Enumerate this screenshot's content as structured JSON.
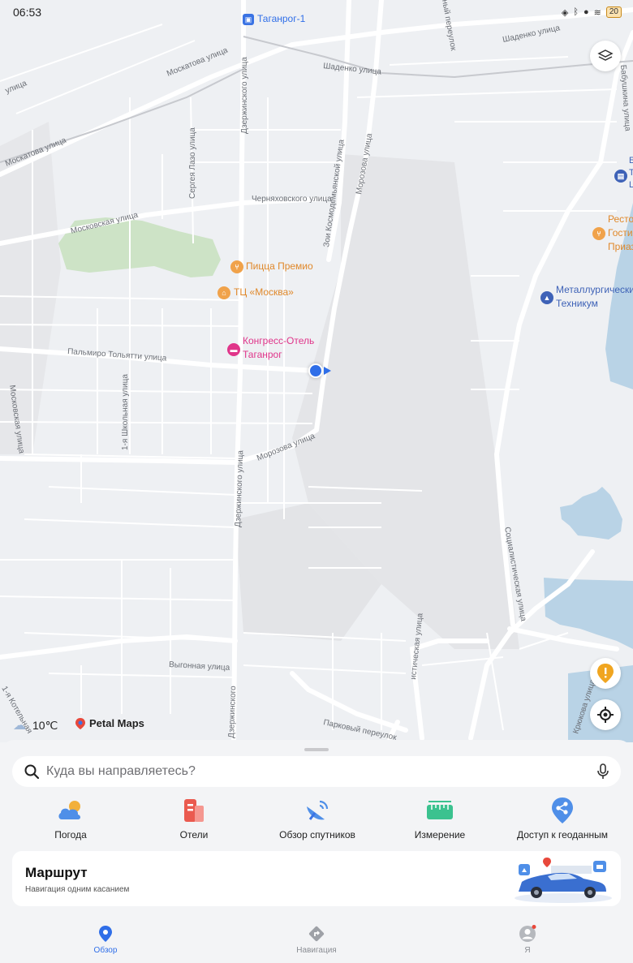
{
  "status": {
    "time": "06:53",
    "battery": "20"
  },
  "map": {
    "station": "Таганрог-1",
    "streets": [
      "Москатова улица",
      "Москатова улица",
      "Шаденко улица",
      "Шаденко улица",
      "улица",
      "Дзержинского улица",
      "Сергея Лазо улица",
      "Черняховского улица",
      "Зои Космодемьянской улица",
      "Морозова улица",
      "Московская улица",
      "Пальмиро Тольятти улица",
      "Московская улица",
      "1-я Школьная улица",
      "Морозова улица",
      "Дзержинского улица",
      "Выгонная улица",
      "Дзержинского",
      "Парковый переулок",
      "1-я Котельная",
      "Социалистическая улица",
      "истическая улица",
      "Бабушкина улица",
      "Крюкова улица",
      "ный переулок"
    ],
    "pois": {
      "pizza": "Пицца Премио",
      "mall": "ТЦ «Москва»",
      "hotel_line1": "Конгресс-Отель",
      "hotel_line2": "Таганрог",
      "college_line1": "Металлургический",
      "college_line2": "Техникум",
      "rest_line1": "Ресто",
      "rest_line2": "Гости",
      "rest_line3": "Приаз",
      "edge_line1": "Б",
      "edge_line2": "Т",
      "edge_line3": "L"
    },
    "weather_temp": "10℃",
    "brand": "Petal Maps"
  },
  "search": {
    "placeholder": "Куда вы направляетесь?"
  },
  "quick_actions": [
    {
      "label": "Погода",
      "icon": "weather-icon"
    },
    {
      "label": "Отели",
      "icon": "hotel-icon"
    },
    {
      "label": "Обзор спутников",
      "icon": "satellite-icon"
    },
    {
      "label": "Измерение",
      "icon": "ruler-icon"
    },
    {
      "label": "Доступ к геоданным",
      "icon": "share-location-icon"
    }
  ],
  "route": {
    "title": "Маршрут",
    "subtitle": "Навигация одним касанием"
  },
  "tabs": [
    {
      "label": "Обзор",
      "active": true
    },
    {
      "label": "Навигация",
      "active": false
    },
    {
      "label": "Я",
      "active": false
    }
  ],
  "colors": {
    "accent": "#2f6ee8",
    "pizza": "#f0a24a",
    "hotel": "#e0358a",
    "college": "#3e62b7",
    "water": "#b9d3e6",
    "park": "#cde3c6"
  }
}
